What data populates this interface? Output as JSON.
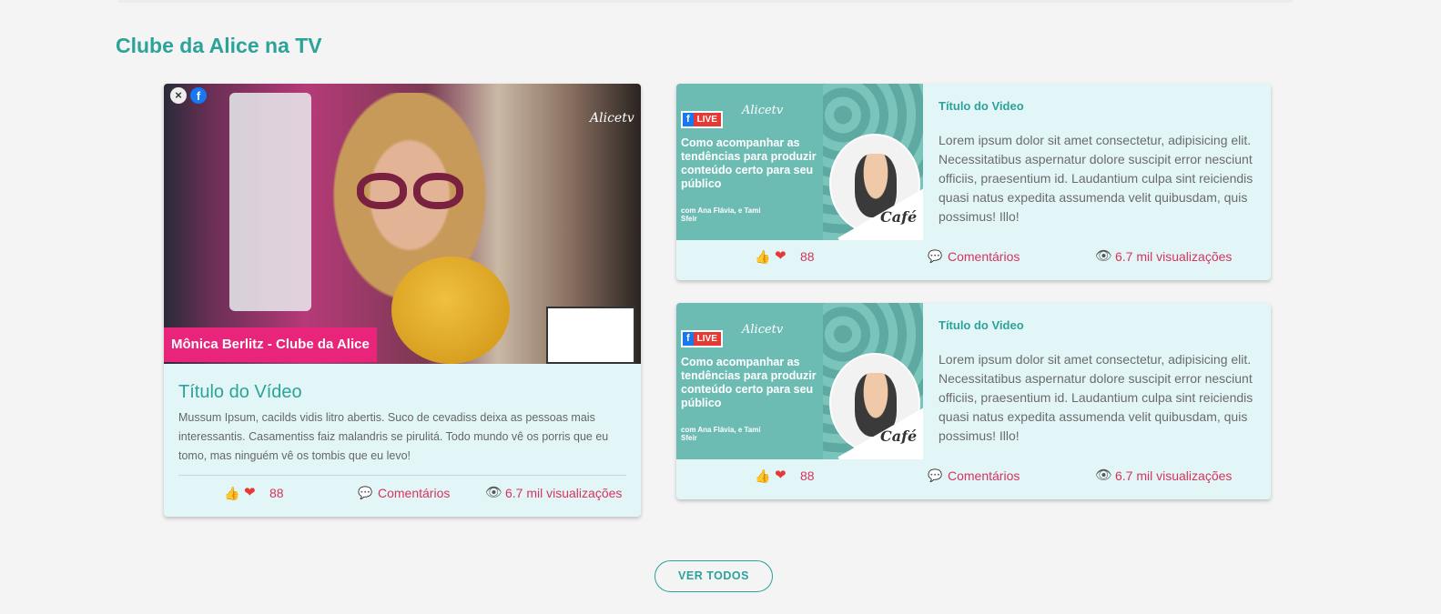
{
  "section": {
    "title": "Clube da Alice na TV"
  },
  "featured": {
    "thumb_caption": "Mônica Berlitz - Clube da Alice",
    "thumb_logo": "Alicetv",
    "title": "Título do Vídeo",
    "description": "Mussum Ipsum, cacilds vidis litro abertis. Suco de cevadiss deixa as pessoas mais interessantis. Casamentiss faiz malandris se pirulitá. Todo mundo vê os porris que eu tomo, mas ninguém vê os tombis que eu levo!",
    "likes": "88",
    "comments_label": "Comentários",
    "views_label": "6.7 mil visualizações"
  },
  "videos": [
    {
      "badge_fb": "f",
      "badge_live": "LIVE",
      "thumb_logo": "Alicetv",
      "thumb_headline": "Como acompanhar as tendências para produzir conteúdo certo para seu público",
      "thumb_hosts": "com Ana Flávia, e Tami Sfeir",
      "thumb_brand": "Café",
      "title": "Título do Video",
      "description": "Lorem ipsum dolor sit amet consectetur, adipisicing elit. Necessitatibus aspernatur dolore suscipit error nesciunt officiis, praesentium id. Laudantium culpa sint reiciendis quasi natus expedita assumenda velit quibusdam, quis possimus! Illo!",
      "likes": "88",
      "comments_label": "Comentários",
      "views_label": "6.7 mil visualizações"
    },
    {
      "badge_fb": "f",
      "badge_live": "LIVE",
      "thumb_logo": "Alicetv",
      "thumb_headline": "Como acompanhar as tendências para produzir conteúdo certo para seu público",
      "thumb_hosts": "com Ana Flávia, e Tami Sfeir",
      "thumb_brand": "Café",
      "title": "Título do Video",
      "description": "Lorem ipsum dolor sit amet consectetur, adipisicing elit. Necessitatibus aspernatur dolore suscipit error nesciunt officiis, praesentium id. Laudantium culpa sint reiciendis quasi natus expedita assumenda velit quibusdam, quis possimus! Illo!",
      "likes": "88",
      "comments_label": "Comentários",
      "views_label": "6.7 mil visualizações"
    }
  ],
  "footer": {
    "ver_todos_label": "VER TODOS"
  },
  "icons": {
    "like": "thumbs-up-icon",
    "heart": "heart-icon",
    "comment": "comment-icon",
    "views": "eye-icon"
  },
  "colors": {
    "accent": "#2ca39a",
    "stat_text": "#d6345c",
    "card_bg": "#e2f6f7",
    "caption_bg": "#e8257a"
  }
}
